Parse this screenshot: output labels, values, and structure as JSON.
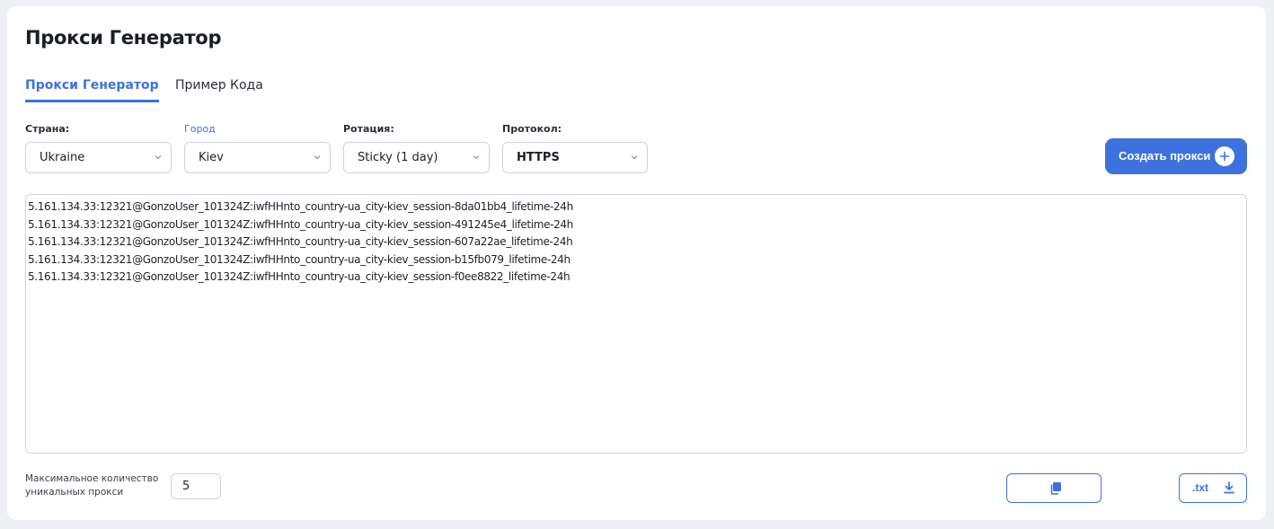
{
  "header": {
    "title": "Прокси Генератор"
  },
  "tabs": [
    {
      "label": "Прокси Генератор",
      "active": true
    },
    {
      "label": "Пример Кода",
      "active": false
    }
  ],
  "filters": {
    "country": {
      "label": "Страна:",
      "value": "Ukraine"
    },
    "city": {
      "label": "Город",
      "value": "Kiev"
    },
    "rotation": {
      "label": "Ротация:",
      "value": "Sticky (1 day)"
    },
    "protocol": {
      "label": "Протокол:",
      "value": "HTTPS"
    }
  },
  "actions": {
    "create_label": "Создать прокси",
    "txt_label": ".txt"
  },
  "proxies": [
    "5.161.134.33:12321@GonzoUser_101324Z:iwfHHnto_country-ua_city-kiev_session-8da01bb4_lifetime-24h",
    "5.161.134.33:12321@GonzoUser_101324Z:iwfHHnto_country-ua_city-kiev_session-491245e4_lifetime-24h",
    "5.161.134.33:12321@GonzoUser_101324Z:iwfHHnto_country-ua_city-kiev_session-607a22ae_lifetime-24h",
    "5.161.134.33:12321@GonzoUser_101324Z:iwfHHnto_country-ua_city-kiev_session-b15fb079_lifetime-24h",
    "5.161.134.33:12321@GonzoUser_101324Z:iwfHHnto_country-ua_city-kiev_session-f0ee8822_lifetime-24h"
  ],
  "footer": {
    "max_label": "Максимальное количество уникальных прокси",
    "count_value": "5"
  },
  "icons": {
    "select": "chevron-down-icon",
    "create": "plus-circle-icon",
    "copy": "copy-icon",
    "download": "download-icon"
  },
  "colors": {
    "accent": "#3d72de",
    "border": "#cfd3da",
    "background": "#eef0f4"
  }
}
